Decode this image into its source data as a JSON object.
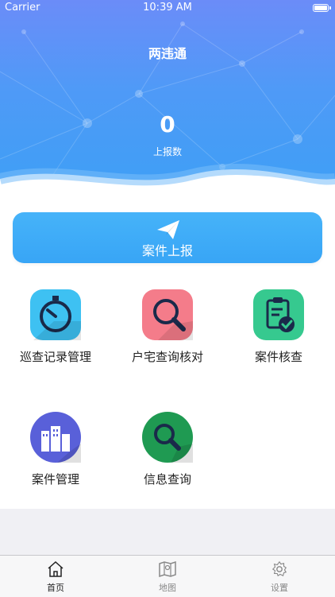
{
  "statusbar": {
    "carrier": "Carrier",
    "time": "10:39 AM"
  },
  "header": {
    "title": "两违通",
    "count": "0",
    "count_label": "上报数"
  },
  "report_button": {
    "label": "案件上报",
    "icon": "paper-plane-icon"
  },
  "tiles": [
    {
      "label": "巡查记录管理",
      "icon": "stopwatch-icon",
      "color": "#3ec1f2"
    },
    {
      "label": "户宅查询核对",
      "icon": "search-icon",
      "color": "#f47c8a"
    },
    {
      "label": "案件核查",
      "icon": "clipboard-check-icon",
      "color": "#36c98f"
    },
    {
      "label": "案件管理",
      "icon": "buildings-icon",
      "color": "#5960d9"
    },
    {
      "label": "信息查询",
      "icon": "search-icon",
      "color": "#1f9a52"
    }
  ],
  "tabbar": {
    "items": [
      {
        "label": "首页",
        "icon": "home-icon",
        "active": true
      },
      {
        "label": "地图",
        "icon": "map-icon",
        "active": false
      },
      {
        "label": "设置",
        "icon": "gear-icon",
        "active": false
      }
    ]
  }
}
